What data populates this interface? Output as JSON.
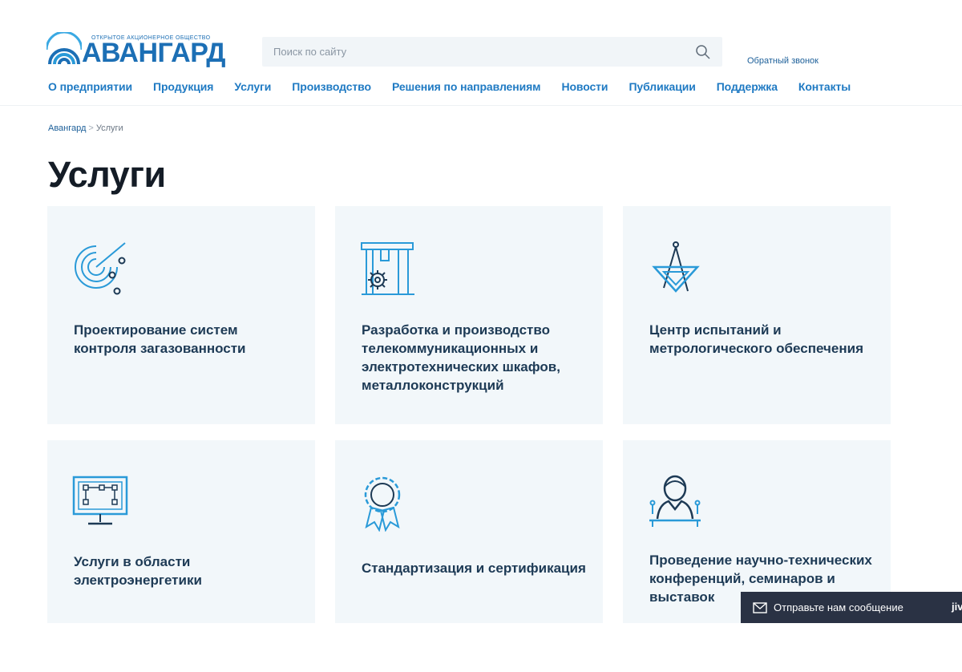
{
  "header": {
    "logo": {
      "subtitle": "Открытое акционерное общество",
      "name": "АВАНГАРД"
    },
    "search": {
      "placeholder": "Поиск по сайту"
    },
    "callback_label": "Обратный звонок"
  },
  "nav": {
    "items": [
      {
        "label": "О предприятии"
      },
      {
        "label": "Продукция"
      },
      {
        "label": "Услуги"
      },
      {
        "label": "Производство"
      },
      {
        "label": "Решения по направлениям"
      },
      {
        "label": "Новости"
      },
      {
        "label": "Публикации"
      },
      {
        "label": "Поддержка"
      },
      {
        "label": "Контакты"
      }
    ]
  },
  "breadcrumb": {
    "home": "Авангард",
    "separator": ">",
    "current": "Услуги"
  },
  "page": {
    "title": "Услуги"
  },
  "cards": [
    {
      "icon": "radar-icon",
      "title": "Проектирование систем контроля загазованности"
    },
    {
      "icon": "factory-gear-icon",
      "title": "Разработка и производство телекоммуникационных и электротехнических шкафов, металлоконструкций"
    },
    {
      "icon": "compass-triangle-icon",
      "title": "Центр испытаний и метрологического обеспечения"
    },
    {
      "icon": "monitor-diagram-icon",
      "title": "Услуги в области электроэнергетики"
    },
    {
      "icon": "rosette-certificate-icon",
      "title": "Стандартизация и сертификация"
    },
    {
      "icon": "conference-speaker-icon",
      "title": "Проведение научно-технических конференций, семинаров и выставок"
    }
  ],
  "chat": {
    "label": "Отправьте нам сообщение",
    "brand": "jiv"
  },
  "colors": {
    "brand": "#1c6fb5",
    "nav": "#1f7ac3",
    "card_bg": "#f2f7fa",
    "card_text": "#1d3a55",
    "chat_bg": "#2a3244"
  }
}
